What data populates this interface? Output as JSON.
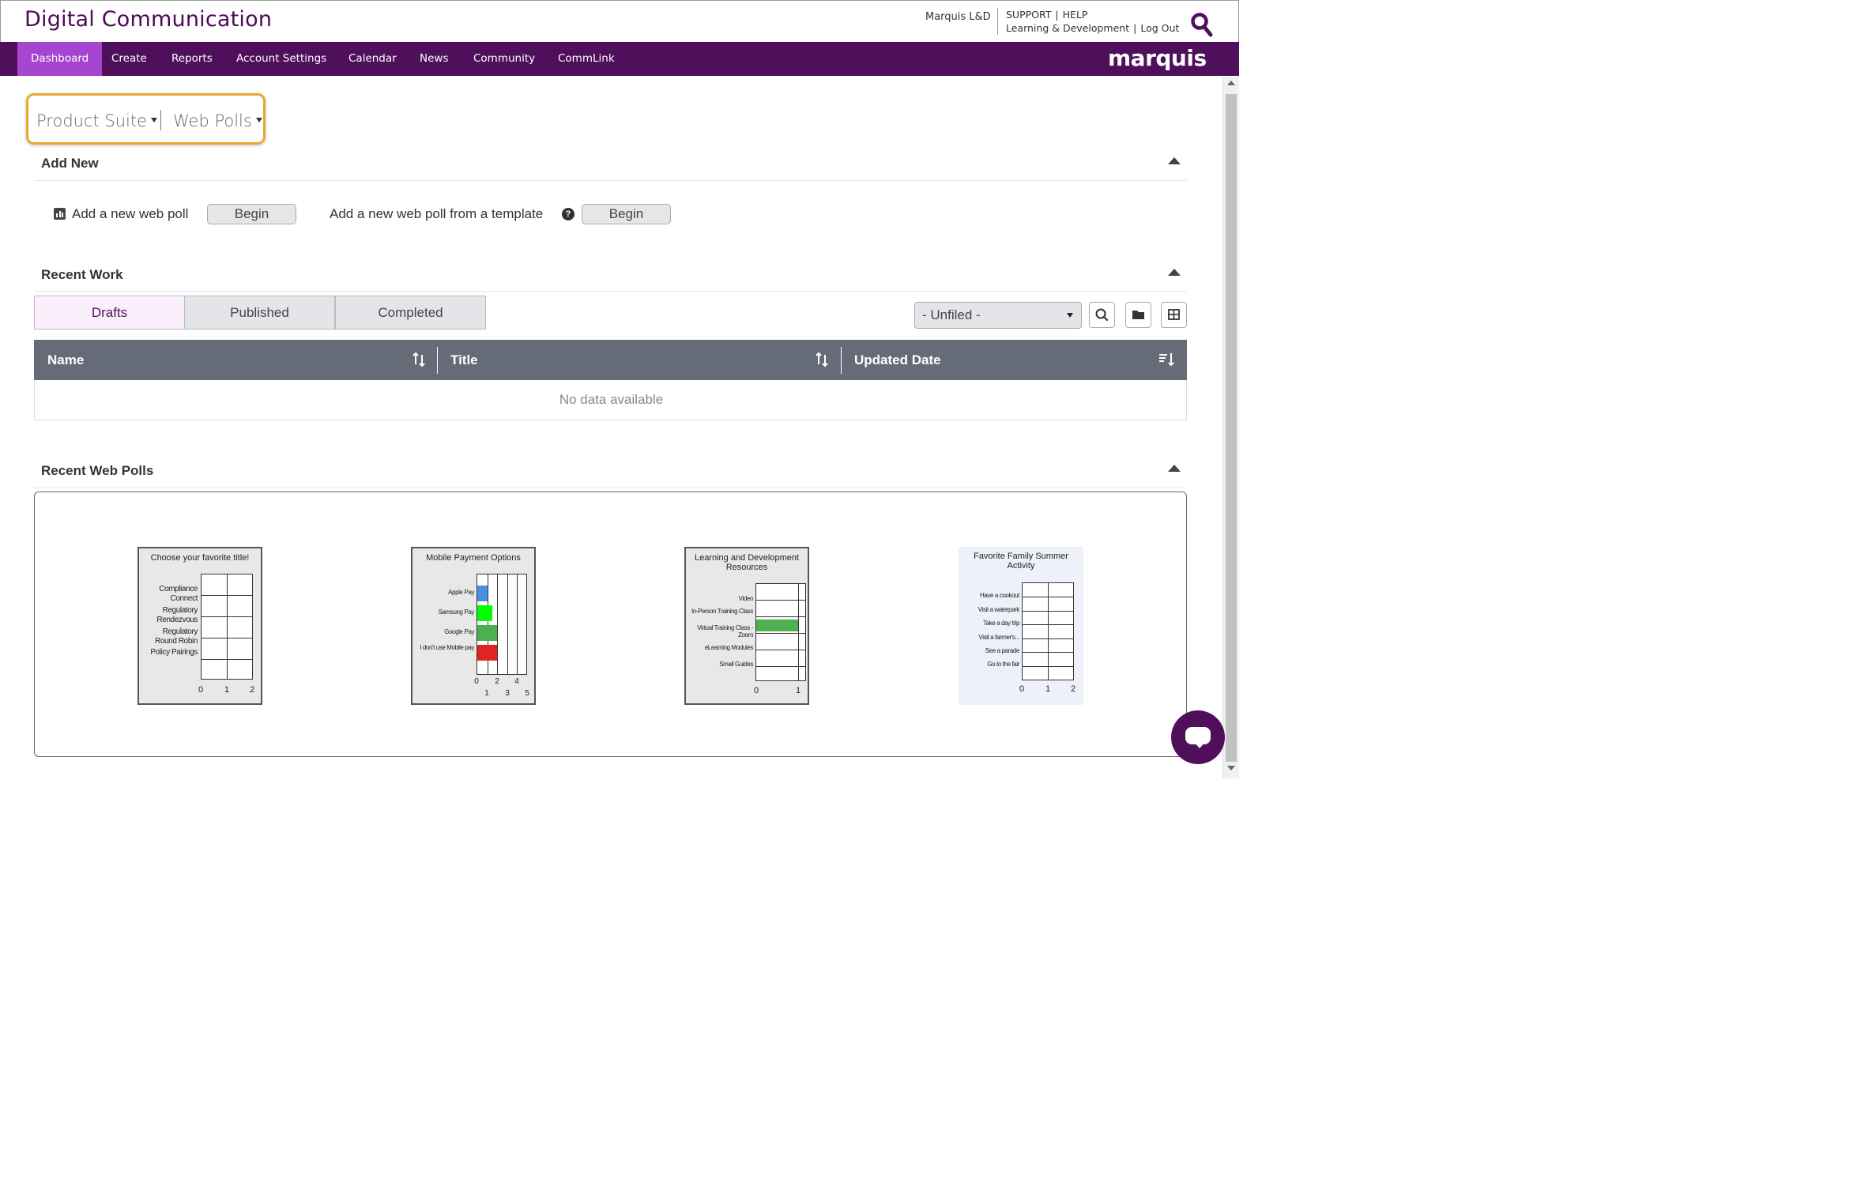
{
  "header": {
    "app_title": "Digital Communication",
    "org_name": "Marquis L&D",
    "support": "SUPPORT",
    "help": "HELP",
    "account": "Learning & Development",
    "logout": "Log Out"
  },
  "nav": {
    "items": [
      "Dashboard",
      "Create",
      "Reports",
      "Account Settings",
      "Calendar",
      "News",
      "Community",
      "CommLink"
    ],
    "active": "Dashboard",
    "brand": "marquis"
  },
  "breadcrumb": {
    "suite": "Product Suite",
    "section": "Web Polls"
  },
  "add_new": {
    "title": "Add New",
    "new_poll_label": "Add a new web poll",
    "template_label": "Add a new web poll from a template",
    "begin_label": "Begin"
  },
  "recent_work": {
    "title": "Recent Work",
    "tabs": [
      "Drafts",
      "Published",
      "Completed"
    ],
    "active_tab": "Drafts",
    "folder_value": "- Unfiled -",
    "columns": [
      "Name",
      "Title",
      "Updated Date"
    ],
    "empty_message": "No data available"
  },
  "recent_polls": {
    "title": "Recent Web Polls",
    "polls": [
      {
        "title": "Choose your favorite title!",
        "options": [
          "Compliance Connect",
          "Regulatory Rendezvous",
          "Regulatory Round Robin",
          "Policy Pairings"
        ],
        "ticks": [
          "0",
          "1",
          "2"
        ]
      },
      {
        "title": "Mobile Payment Options",
        "options": [
          "Apple Pay",
          "Samsung Pay",
          "Google Pay",
          "I don't use Mobile pay"
        ],
        "ticks_top": [
          "0",
          "2",
          "4"
        ],
        "ticks_bottom": [
          "1",
          "3",
          "5"
        ],
        "values": [
          1,
          1.5,
          2,
          2
        ],
        "max": 5,
        "colors": [
          "#4a90e2",
          "#00ff00",
          "#4caf50",
          "#e02424"
        ]
      },
      {
        "title": "Learning and Development Resources",
        "options": [
          "Video",
          "In-Person Training Class",
          "Virtual Training Class - Zoom",
          "eLearning Modules",
          "Small Guides"
        ],
        "ticks": [
          "0",
          "1"
        ],
        "values": [
          0,
          0,
          1,
          0,
          0
        ],
        "max": 1.2,
        "colors": [
          "#4caf50"
        ]
      },
      {
        "title": "Favorite Family Summer Activity",
        "options": [
          "Have a cookout",
          "Visit a waterpark",
          "Take a day trip",
          "Visit a farmer's...",
          "See a parade",
          "Go to the fair"
        ],
        "ticks": [
          "0",
          "1",
          "2"
        ]
      }
    ]
  },
  "colors": {
    "brand_purple": "#4f0f5b",
    "active_nav": "#a545d0",
    "highlight": "#e6aa2f",
    "table_header": "#666c77"
  }
}
